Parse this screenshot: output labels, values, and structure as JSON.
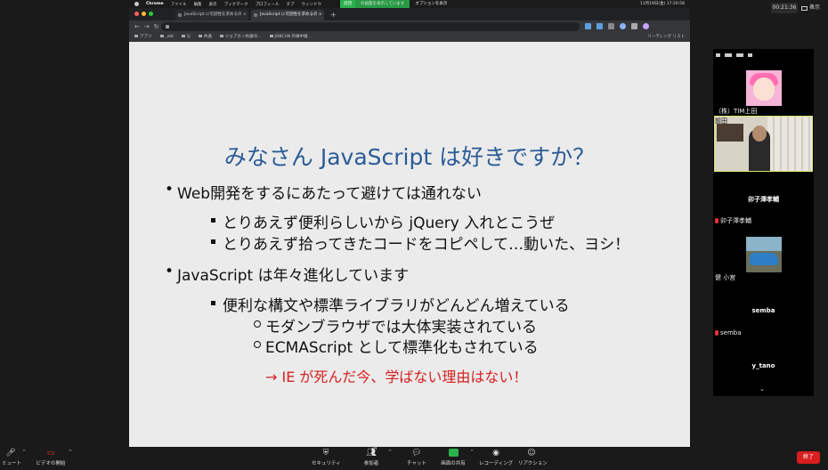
{
  "zoom": {
    "timer": "00:21:36",
    "display_label": "表示",
    "participants_count": "24",
    "toolbar": {
      "mute": "ミュート",
      "start_video": "ビデオの開始",
      "security": "セキュリティ",
      "participants": "参加者",
      "chat": "チャット",
      "share_screen": "画面の共有",
      "record": "レコーディング",
      "reactions": "リアクション",
      "end": "終了"
    },
    "share_bar": {
      "stop": "前回",
      "showing": "の画面を表示しています",
      "options": "オプションを表示"
    }
  },
  "mac": {
    "menu": [
      "Chrome",
      "ファイル",
      "編集",
      "表示",
      "ブックマーク",
      "プロフィール",
      "タブ",
      "ウィンドウ"
    ],
    "clock": "11月19日(金) 17:20:58"
  },
  "browser": {
    "tabs": [
      {
        "label": "JavaScript に可読性を求めるの ×"
      },
      {
        "label": "JavaScript に可読性を求めるの ×"
      }
    ],
    "bookmarks": [
      "アプリ",
      "_old",
      "1j",
      "共通",
      "ジョブカン共通ID…",
      "JOBCAN 外線中継…"
    ],
    "reading_list": "リーディング リスト"
  },
  "slide": {
    "title": "みなさん JavaScript は好きですか？",
    "bullets": [
      {
        "level": 1,
        "text": "Web開発をするにあたって避けては通れない"
      },
      {
        "level": 2,
        "text": "とりあえず便利らしいから jQuery 入れとこうぜ"
      },
      {
        "level": 2,
        "text": "とりあえず拾ってきたコードをコピペして…動いた、ヨシ！"
      },
      {
        "level": 1,
        "text": "JavaScript は年々進化しています"
      },
      {
        "level": 2,
        "text": "便利な構文や標準ライブラリがどんどん増えている"
      },
      {
        "level": 3,
        "text": "モダンブラウザでは大体実装されている"
      },
      {
        "level": 3,
        "text": "ECMAScript として標準化もされている"
      }
    ],
    "conclusion": "→ IE が死んだ今、学ばない理由はない！"
  },
  "participants": [
    {
      "name": "（株）TIM上田"
    },
    {
      "name": "前田"
    },
    {
      "name": "卯子澤孝輔"
    },
    {
      "name": "卯子澤孝輔"
    },
    {
      "name": "健 小宮"
    },
    {
      "name": "semba"
    },
    {
      "name": "semba"
    },
    {
      "name": "y_tano"
    }
  ],
  "colors": {
    "title_blue": "#2b5c97",
    "red_text": "#d52020",
    "zoom_green": "#2bb24c",
    "end_red": "#d81e1e"
  }
}
